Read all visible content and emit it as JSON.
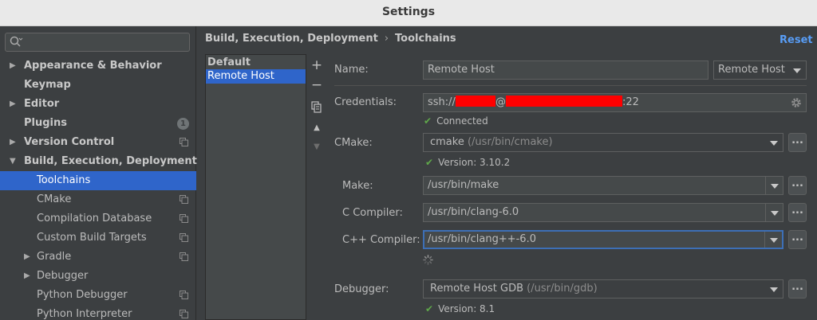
{
  "window": {
    "title": "Settings"
  },
  "search": {
    "placeholder": ""
  },
  "sidebar": {
    "items": [
      {
        "label": "Appearance & Behavior",
        "expander": "▶",
        "bold": true
      },
      {
        "label": "Keymap",
        "bold": true
      },
      {
        "label": "Editor",
        "expander": "▶",
        "bold": true
      },
      {
        "label": "Plugins",
        "bold": true,
        "badge": "1"
      },
      {
        "label": "Version Control",
        "expander": "▶",
        "bold": true
      },
      {
        "label": "Build, Execution, Deployment",
        "expander": "▼",
        "bold": true
      },
      {
        "label": "Toolchains",
        "selected": true
      },
      {
        "label": "CMake"
      },
      {
        "label": "Compilation Database"
      },
      {
        "label": "Custom Build Targets"
      },
      {
        "label": "Gradle",
        "expander": "▶"
      },
      {
        "label": "Debugger",
        "expander": "▶"
      },
      {
        "label": "Python Debugger"
      },
      {
        "label": "Python Interpreter"
      }
    ]
  },
  "breadcrumb": {
    "parent": "Build, Execution, Deployment",
    "separator": "›",
    "current": "Toolchains"
  },
  "reset_label": "Reset",
  "toolchains": {
    "header": "Default",
    "items": [
      {
        "label": "Remote Host",
        "selected": true
      }
    ]
  },
  "toolbar": {
    "add": "+",
    "remove": "−",
    "copy": "copy",
    "move_up": "▲",
    "move_down": "▼"
  },
  "form": {
    "name": {
      "label": "Name:",
      "value": "Remote Host",
      "type_value": "Remote Host"
    },
    "credentials": {
      "label": "Credentials:",
      "prefix": "ssh://",
      "at": "@",
      "port": ":22",
      "status": "Connected"
    },
    "cmake": {
      "label": "CMake:",
      "value": "cmake",
      "hint": "(/usr/bin/cmake)",
      "status": "Version: 3.10.2"
    },
    "make": {
      "label": "Make:",
      "value": "/usr/bin/make"
    },
    "c_compiler": {
      "label": "C Compiler:",
      "value": "/usr/bin/clang-6.0"
    },
    "cpp_compiler": {
      "label": "C++ Compiler:",
      "value": "/usr/bin/clang++-6.0"
    },
    "debugger": {
      "label": "Debugger:",
      "value": "Remote Host GDB",
      "hint": "(/usr/bin/gdb)",
      "status": "Version: 8.1"
    },
    "browse_label": "..."
  },
  "colors": {
    "accent": "#2f65ca",
    "link": "#589df6",
    "ok": "#5fa84a",
    "redaction": "#ff0000"
  },
  "icons": {
    "search": "search-icon",
    "copy": "copy-icon",
    "gear": "gear-icon",
    "check": "check-icon",
    "spinner": "spinner-icon"
  }
}
